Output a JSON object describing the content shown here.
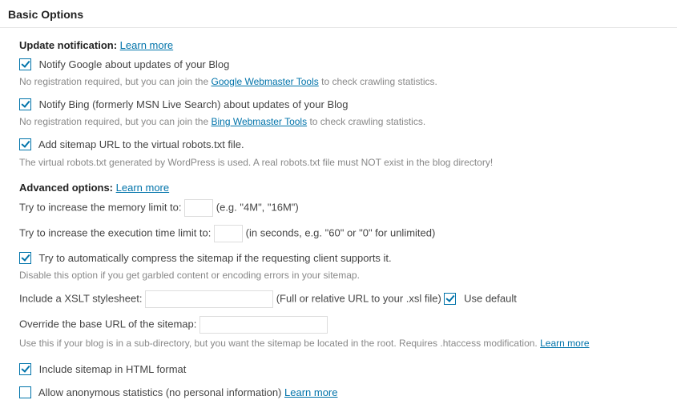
{
  "title": "Basic Options",
  "updateNotification": {
    "label": "Update notification:",
    "learnMore": "Learn more"
  },
  "notifyGoogle": {
    "checked": true,
    "label": "Notify Google about updates of your Blog",
    "descPrefix": "No registration required, but you can join the ",
    "linkText": "Google Webmaster Tools",
    "descSuffix": " to check crawling statistics."
  },
  "notifyBing": {
    "checked": true,
    "label": "Notify Bing (formerly MSN Live Search) about updates of your Blog",
    "descPrefix": "No registration required, but you can join the ",
    "linkText": "Bing Webmaster Tools",
    "descSuffix": " to check crawling statistics."
  },
  "robotsTxt": {
    "checked": true,
    "label": "Add sitemap URL to the virtual robots.txt file.",
    "desc": "The virtual robots.txt generated by WordPress is used. A real robots.txt file must NOT exist in the blog directory!"
  },
  "advanced": {
    "label": "Advanced options:",
    "learnMore": "Learn more"
  },
  "memoryLimit": {
    "label": "Try to increase the memory limit to:",
    "hint": "(e.g. \"4M\", \"16M\")",
    "value": ""
  },
  "execTime": {
    "label": "Try to increase the execution time limit to:",
    "hint": "(in seconds, e.g. \"60\" or \"0\" for unlimited)",
    "value": ""
  },
  "compress": {
    "checked": true,
    "label": "Try to automatically compress the sitemap if the requesting client supports it.",
    "desc": "Disable this option if you get garbled content or encoding errors in your sitemap."
  },
  "xslt": {
    "label": "Include a XSLT stylesheet:",
    "value": "",
    "hint": "(Full or relative URL to your .xsl file)",
    "useDefaultChecked": true,
    "useDefaultLabel": "Use default"
  },
  "baseUrl": {
    "label": "Override the base URL of the sitemap:",
    "value": "",
    "desc": "Use this if your blog is in a sub-directory, but you want the sitemap be located in the root. Requires .htaccess modification.",
    "learnMore": "Learn more"
  },
  "htmlFormat": {
    "checked": true,
    "label": "Include sitemap in HTML format"
  },
  "anonStats": {
    "checked": false,
    "label": "Allow anonymous statistics (no personal information)",
    "learnMore": "Learn more"
  }
}
